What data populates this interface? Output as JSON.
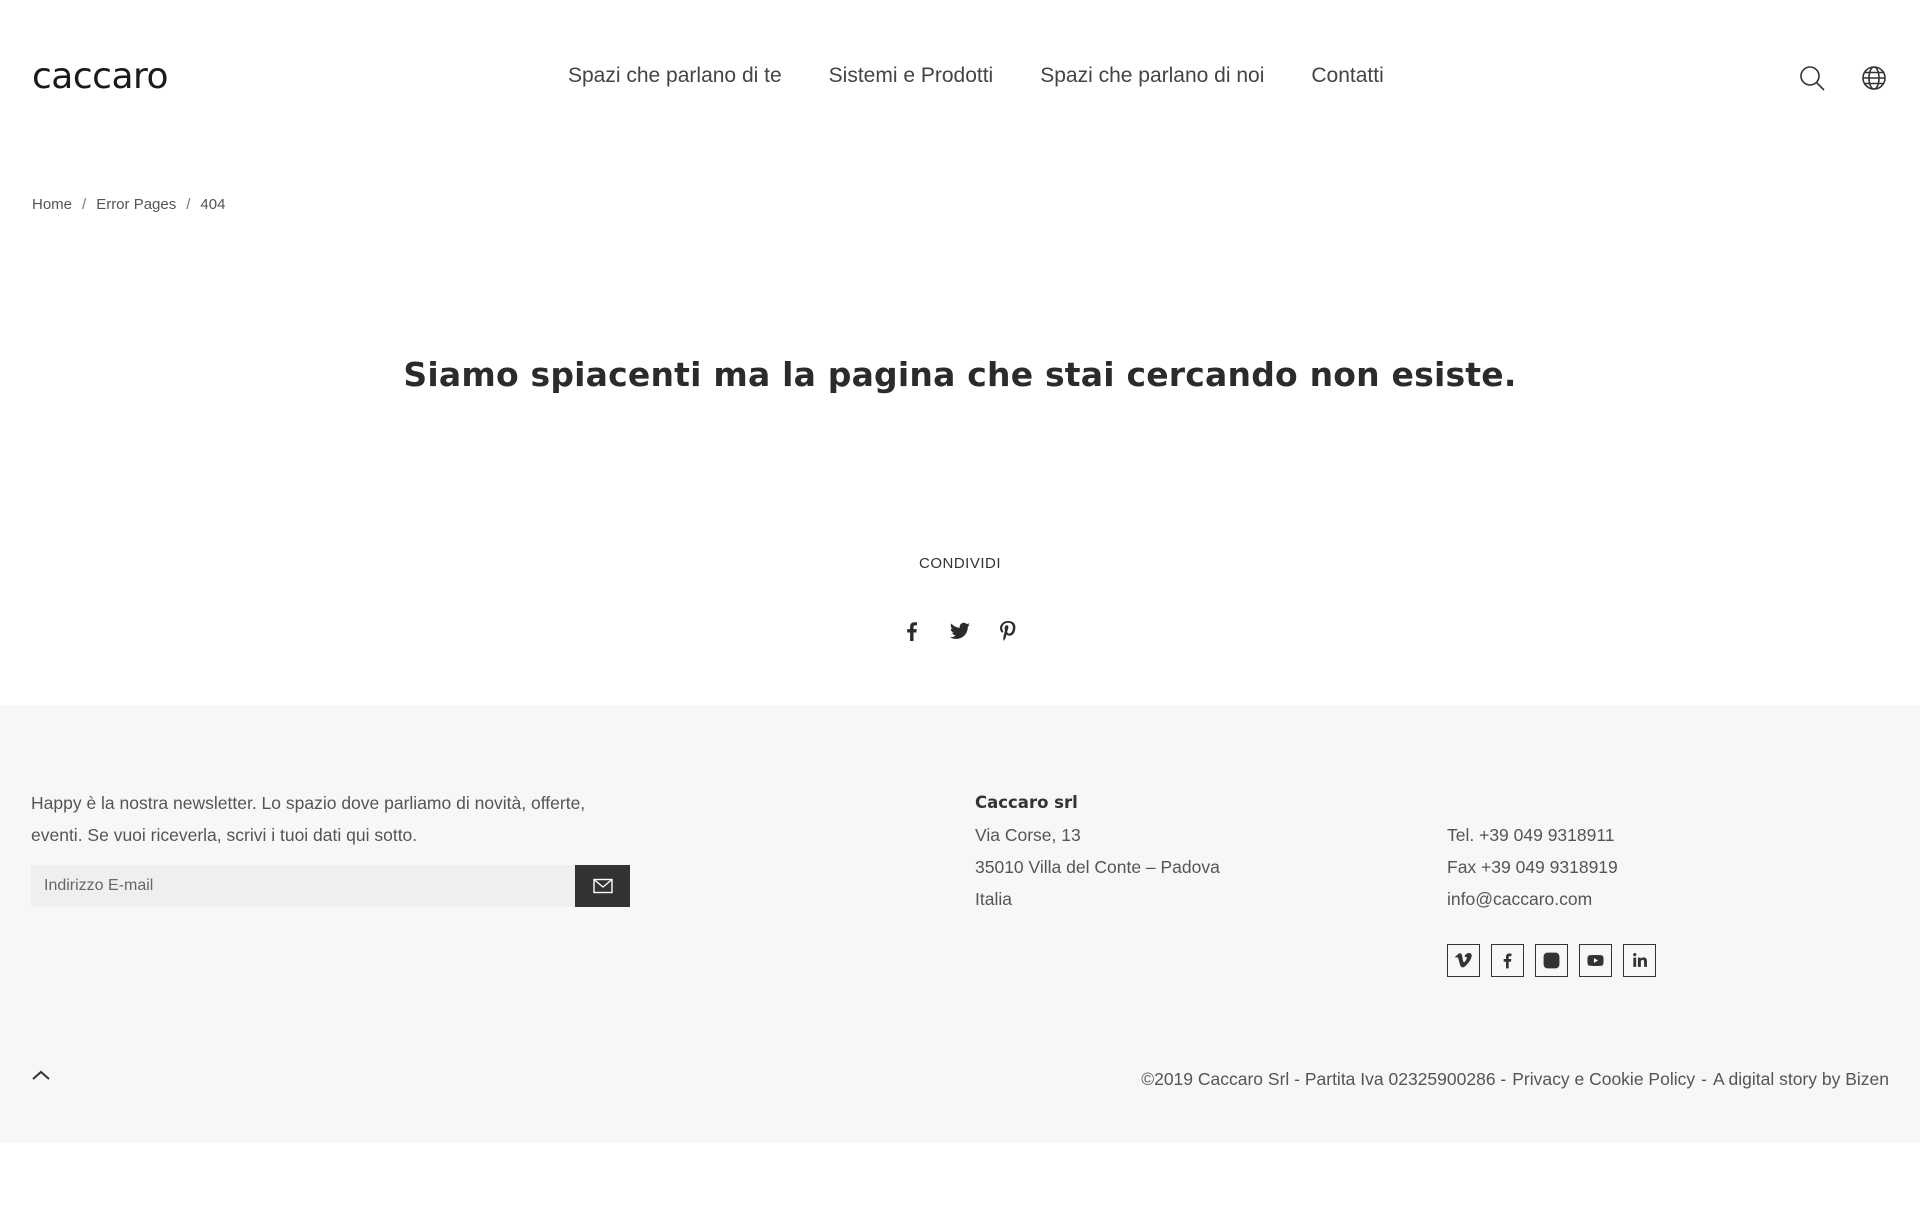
{
  "header": {
    "logo": "caccaro",
    "nav": [
      {
        "label": "Spazi che parlano di te"
      },
      {
        "label": "Sistemi e Prodotti"
      },
      {
        "label": "Spazi che parlano di noi"
      },
      {
        "label": "Contatti"
      }
    ],
    "icons": {
      "search": "search-icon",
      "language": "globe-icon"
    }
  },
  "breadcrumb": {
    "items": [
      "Home",
      "Error Pages",
      "404"
    ],
    "separator": "/"
  },
  "main": {
    "message": "Siamo spiacenti ma la pagina che stai cercando non esiste.",
    "share_label": "CONDIVIDI",
    "share_icons": [
      "facebook-icon",
      "twitter-icon",
      "pinterest-icon"
    ]
  },
  "footer": {
    "newsletter_text": "Happy è la nostra newsletter. Lo spazio dove parliamo di novità, offerte, eventi. Se vuoi riceverla, scrivi i tuoi dati qui sotto.",
    "email_placeholder": "Indirizzo E-mail",
    "company": {
      "name": "Caccaro srl",
      "address1": "Via Corse, 13",
      "address2": "35010 Villa del Conte – Padova",
      "country": "Italia"
    },
    "contact": {
      "tel": "Tel. +39 049 9318911",
      "fax": "Fax +39 049 9318919",
      "email": "info@caccaro.com"
    },
    "socials": [
      "vimeo-icon",
      "facebook-icon",
      "instagram-icon",
      "youtube-icon",
      "linkedin-icon"
    ],
    "copyright": "©2019 Caccaro Srl - Partita Iva 02325900286 -",
    "privacy_link": "Privacy e Cookie Policy",
    "credit_prefix": "-",
    "credit_link": "A digital story by Bizen"
  },
  "colors": {
    "text_dark": "#2b2b2b",
    "footer_bg": "#f7f7f7",
    "button_bg": "#333333"
  }
}
